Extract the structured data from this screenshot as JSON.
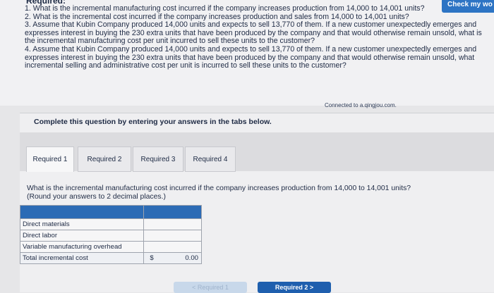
{
  "header": {
    "required_heading": "Required:",
    "check_button": "Check my wo"
  },
  "questions": [
    "1. What is the incremental manufacturing cost incurred if the company increases production from 14,000 to 14,001 units?",
    "2. What is the incremental cost incurred if the company increases production and sales from 14,000 to 14,001 units?",
    "3. Assume that Kubin Company produced 14,000 units and expects to sell 13,770 of them. If a new customer unexpectedly emerges and expresses interest in buying the 230 extra units that have been produced by the company and that would otherwise remain unsold, what is the incremental manufacturing cost per unit incurred to sell these units to the customer?",
    "4. Assume that Kubin Company produced 14,000 units and expects to sell 13,770 of them. If a new customer unexpectedly emerges and expresses interest in buying the 230 extra units that have been produced by the company and that would otherwise remain unsold, what incremental selling and administrative cost per unit is incurred to sell these units to the customer?"
  ],
  "connected_note": "Connected to a.qingjou.com.",
  "instructions": "Complete this question by entering your answers in the tabs below.",
  "tabs": [
    "Required 1",
    "Required 2",
    "Required 3",
    "Required 4"
  ],
  "prompt": {
    "line1": "What is the incremental manufacturing cost incurred if the company increases production from 14,000 to 14,001 units?",
    "line2": "(Round your answers to 2 decimal places.)"
  },
  "table": {
    "rows": [
      "Direct materials",
      "Direct labor",
      "Variable manufacturing overhead"
    ],
    "total_label": "Total incremental cost",
    "total_currency": "$",
    "total_value": "0.00"
  },
  "nav": {
    "prev": "< Required 1",
    "next": "Required 2 >"
  }
}
